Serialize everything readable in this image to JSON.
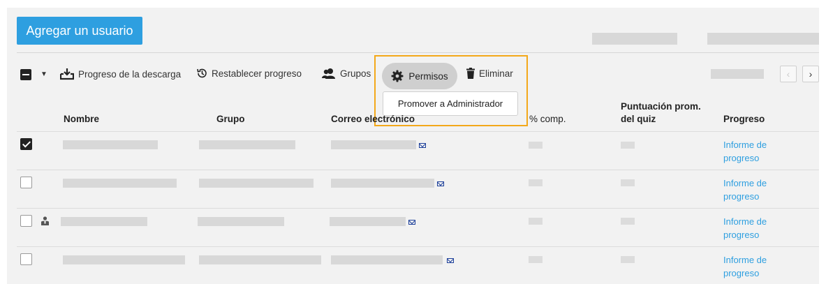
{
  "header": {
    "add_user_label": "Agregar un usuario"
  },
  "toolbar": {
    "download_label": "Progreso de la descarga",
    "reset_label": "Restablecer progreso",
    "groups_label": "Grupos",
    "permissions_label": "Permisos",
    "delete_label": "Eliminar"
  },
  "dropdown": {
    "promote_label": "Promover a Administrador"
  },
  "pager": {
    "prev_icon": "chevron-left-icon",
    "next_icon": "chevron-right-icon",
    "prev": "‹",
    "next": "›"
  },
  "table": {
    "columns": {
      "nombre": "Nombre",
      "grupo": "Grupo",
      "correo": "Correo electrónico",
      "comp": "% comp.",
      "quiz_line1": "Puntuación prom.",
      "quiz_line2": "del quiz",
      "progreso": "Progreso"
    },
    "rows": [
      {
        "checked": true,
        "admin": false,
        "link_line1": "Informe de",
        "link_line2": "progreso"
      },
      {
        "checked": false,
        "admin": false,
        "link_line1": "Informe de",
        "link_line2": "progreso"
      },
      {
        "checked": false,
        "admin": true,
        "link_line1": "Informe de",
        "link_line2": "progreso"
      },
      {
        "checked": false,
        "admin": false,
        "link_line1": "Informe de",
        "link_line2": "progreso"
      }
    ]
  },
  "colors": {
    "accent": "#2e9fe0",
    "highlight": "#f3a81a"
  }
}
